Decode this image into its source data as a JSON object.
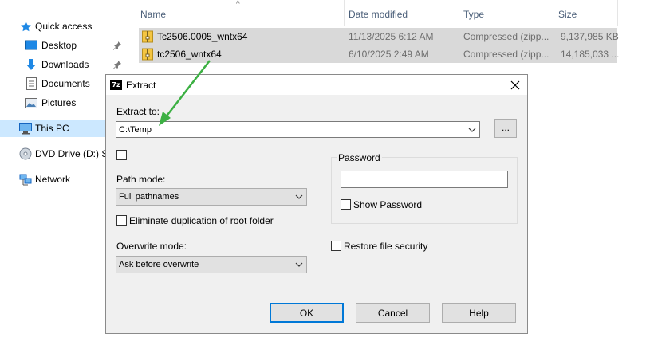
{
  "nav": {
    "items": [
      {
        "label": "Quick access",
        "icon": "star-icon"
      },
      {
        "label": "Desktop",
        "icon": "desktop-icon",
        "pinned": true
      },
      {
        "label": "Downloads",
        "icon": "download-arrow-icon",
        "pinned": true
      },
      {
        "label": "Documents",
        "icon": "documents-icon"
      },
      {
        "label": "Pictures",
        "icon": "pictures-icon"
      },
      {
        "label": "This PC",
        "icon": "computer-icon",
        "selected": true
      },
      {
        "label": "DVD Drive (D:) SS",
        "icon": "dvd-drive-icon"
      },
      {
        "label": "Network",
        "icon": "network-icon"
      }
    ]
  },
  "file_list": {
    "columns": [
      "Name",
      "Date modified",
      "Type",
      "Size"
    ],
    "rows": [
      {
        "name": "Tc2506.0005_wntx64",
        "date": "11/13/2025 6:12 AM",
        "type": "Compressed (zipp...",
        "size": "9,137,985 KB"
      },
      {
        "name": "tc2506_wntx64",
        "date": "6/10/2025 2:49 AM",
        "type": "Compressed (zipp...",
        "size": "14,185,033 ..."
      }
    ]
  },
  "dialog": {
    "title": "Extract",
    "app_icon_text": "7z",
    "extract_to_label": "Extract to:",
    "extract_to_value": "C:\\Temp",
    "browse_label": "...",
    "path_mode_label": "Path mode:",
    "path_mode_value": "Full pathnames",
    "eliminate_label": "Eliminate duplication of root folder",
    "overwrite_mode_label": "Overwrite mode:",
    "overwrite_mode_value": "Ask before overwrite",
    "password_group_label": "Password",
    "password_value": "",
    "show_password_label": "Show Password",
    "restore_security_label": "Restore file security",
    "buttons": {
      "ok": "OK",
      "cancel": "Cancel",
      "help": "Help"
    }
  },
  "colors": {
    "selection": "#cce8ff",
    "row_highlight": "#d9d9d9",
    "dialog_bg": "#f0f0f0",
    "default_button_border": "#0078d7",
    "annotation_arrow": "#3cb043"
  }
}
